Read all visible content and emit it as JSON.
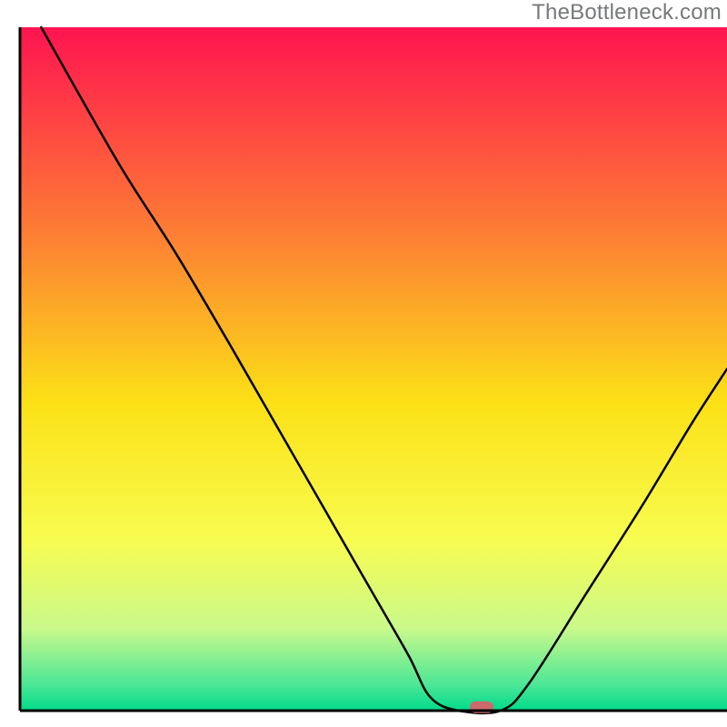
{
  "watermark": "TheBottleneck.com",
  "chart_data": {
    "type": "line",
    "title": "",
    "xlabel": "",
    "ylabel": "",
    "xlim": [
      0,
      100
    ],
    "ylim": [
      0,
      100
    ],
    "background_gradient": {
      "stops": [
        {
          "offset": 0.0,
          "color": "#ff1450"
        },
        {
          "offset": 0.3,
          "color": "#fd7d34"
        },
        {
          "offset": 0.55,
          "color": "#fbe116"
        },
        {
          "offset": 0.75,
          "color": "#f8fc50"
        },
        {
          "offset": 0.88,
          "color": "#c9f98b"
        },
        {
          "offset": 0.96,
          "color": "#4fe796"
        },
        {
          "offset": 1.0,
          "color": "#00db8a"
        }
      ]
    },
    "curve": [
      {
        "x": 3.0,
        "y": 100.0
      },
      {
        "x": 14.0,
        "y": 80.0
      },
      {
        "x": 22.0,
        "y": 67.0
      },
      {
        "x": 30.0,
        "y": 53.0
      },
      {
        "x": 40.0,
        "y": 35.0
      },
      {
        "x": 50.0,
        "y": 17.0
      },
      {
        "x": 55.0,
        "y": 8.0
      },
      {
        "x": 58.0,
        "y": 2.0
      },
      {
        "x": 62.0,
        "y": 0.0
      },
      {
        "x": 68.0,
        "y": 0.0
      },
      {
        "x": 72.0,
        "y": 4.0
      },
      {
        "x": 80.0,
        "y": 17.0
      },
      {
        "x": 88.0,
        "y": 30.0
      },
      {
        "x": 95.0,
        "y": 42.0
      },
      {
        "x": 100.0,
        "y": 50.0
      }
    ],
    "marker": {
      "x": 65.3,
      "y": 0.5,
      "color": "#cc6a6c"
    },
    "axis_color": "#000000",
    "axis_width": 3,
    "curve_color": "#000000",
    "curve_width": 2.5
  }
}
